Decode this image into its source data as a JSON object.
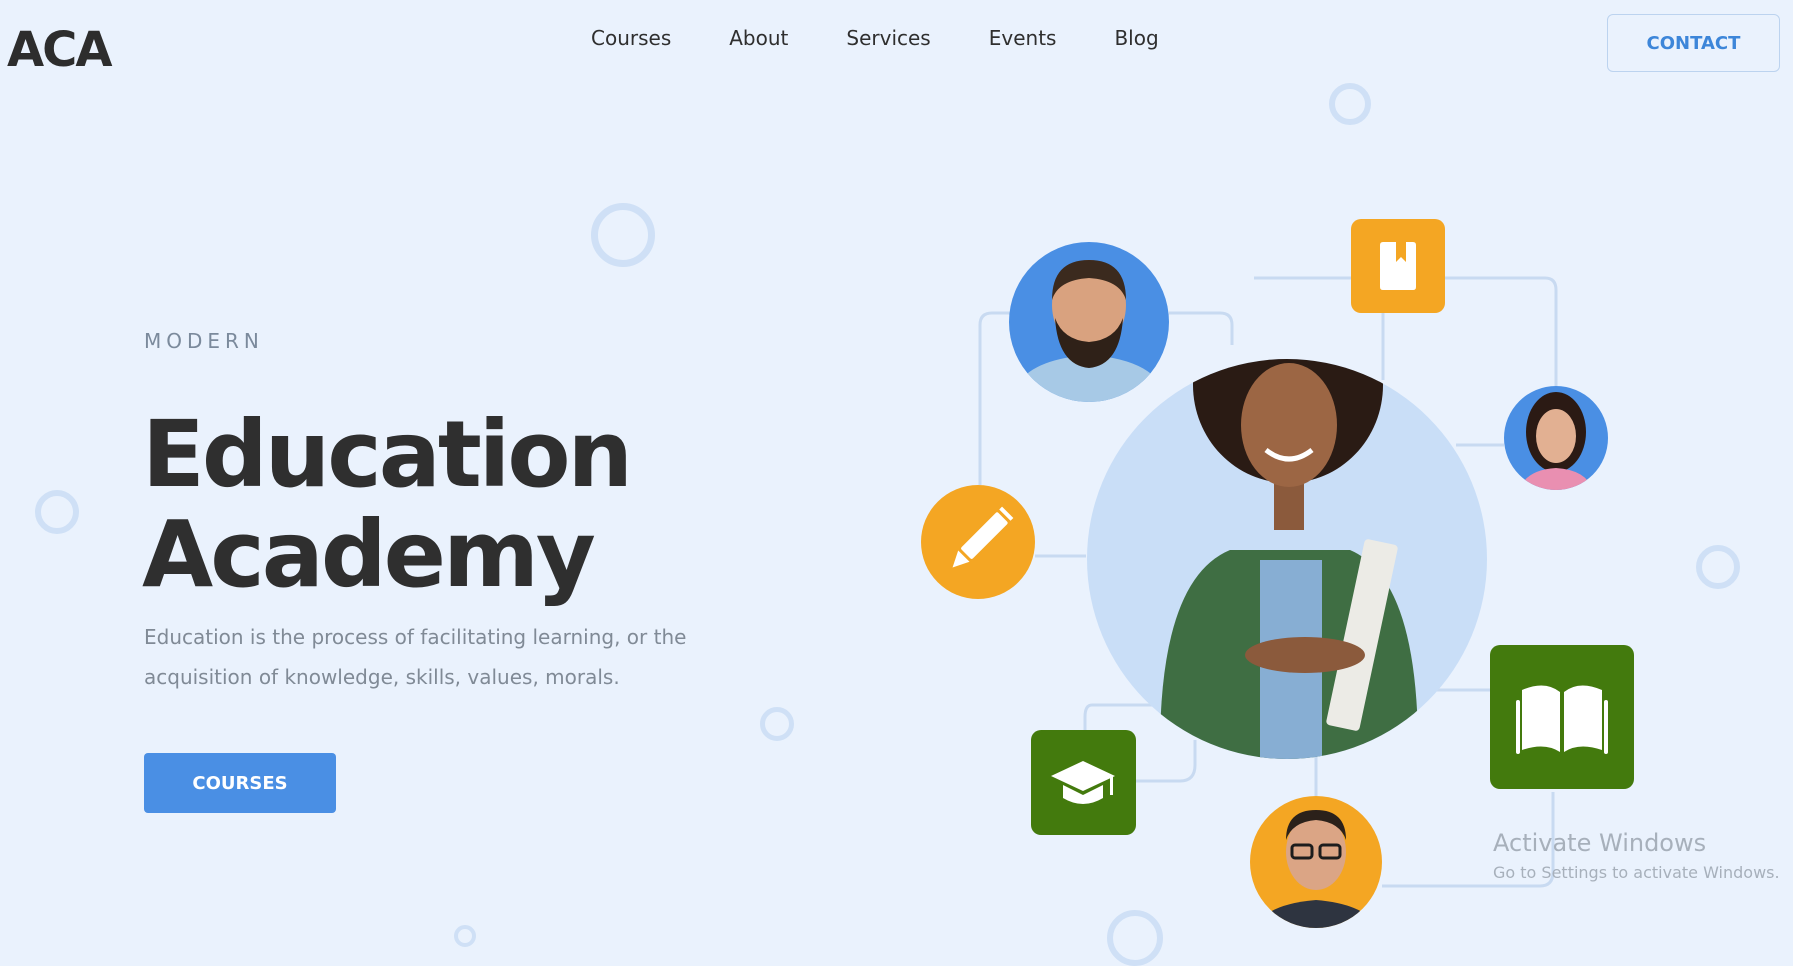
{
  "header": {
    "logo": "ACA",
    "nav": [
      {
        "label": "Courses"
      },
      {
        "label": "About"
      },
      {
        "label": "Services"
      },
      {
        "label": "Events"
      },
      {
        "label": "Blog"
      }
    ],
    "contact_label": "CONTACT"
  },
  "hero": {
    "eyebrow": "MODERN",
    "title_line1": "Education",
    "title_line2": "Academy",
    "description": "Education is the process of facilitating learning, or the acquisition of knowledge, skills, values, morals.",
    "cta_label": "COURSES"
  },
  "illustration": {
    "icons": [
      "pencil-icon",
      "bookmark-icon",
      "open-book-icon",
      "graduation-cap-icon"
    ]
  },
  "watermark": {
    "title": "Activate Windows",
    "subtitle": "Go to Settings to activate Windows."
  },
  "colors": {
    "background": "#eaf2fd",
    "accent_blue": "#4a8fe4",
    "orange": "#f4a623",
    "green": "#437a0d"
  }
}
